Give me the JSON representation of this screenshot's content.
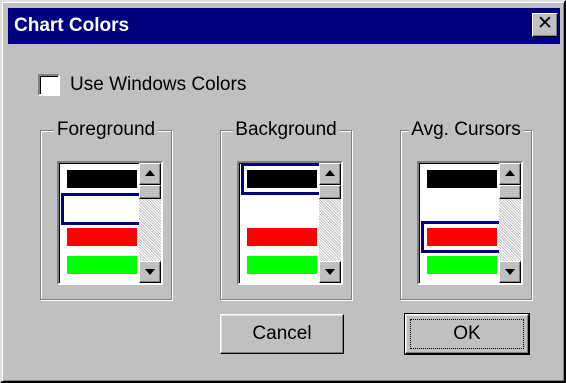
{
  "window": {
    "title": "Chart Colors",
    "close_glyph": "✕"
  },
  "checkbox": {
    "label": "Use Windows Colors",
    "checked": false
  },
  "groups": [
    {
      "title": "Foreground",
      "items": [
        {
          "color": "#000000",
          "selected": false
        },
        {
          "color": "#ffffff",
          "selected": true
        },
        {
          "color": "#ff0000",
          "selected": false
        },
        {
          "color": "#00ff00",
          "selected": false
        }
      ]
    },
    {
      "title": "Background",
      "items": [
        {
          "color": "#000000",
          "selected": true
        },
        {
          "color": "#ffffff",
          "selected": false
        },
        {
          "color": "#ff0000",
          "selected": false
        },
        {
          "color": "#00ff00",
          "selected": false
        }
      ]
    },
    {
      "title": "Avg. Cursors",
      "items": [
        {
          "color": "#000000",
          "selected": false
        },
        {
          "color": "#ffffff",
          "selected": false
        },
        {
          "color": "#ff0000",
          "selected": true
        },
        {
          "color": "#00ff00",
          "selected": false
        }
      ]
    }
  ],
  "buttons": {
    "cancel": "Cancel",
    "ok": "OK"
  },
  "icons": {
    "close": "close-icon",
    "scroll_up": "arrow-up-icon",
    "scroll_down": "arrow-down-icon"
  },
  "colors": {
    "titlebar": "#000080",
    "face": "#c0c0c0",
    "selection_border": "#000080"
  }
}
